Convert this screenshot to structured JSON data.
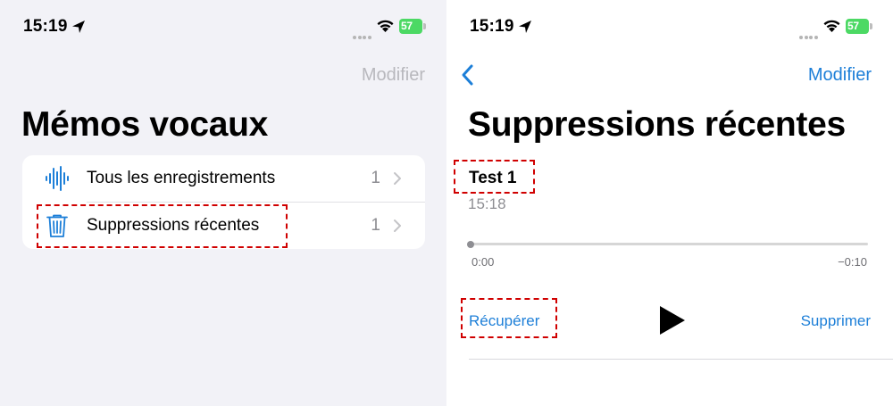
{
  "left_screen": {
    "status_time": "15:19",
    "battery_level": "57",
    "nav_edit_label": "Modifier",
    "title": "Mémos vocaux",
    "rows": [
      {
        "icon": "waveform-icon",
        "label": "Tous les enregistrements",
        "count": "1"
      },
      {
        "icon": "trash-icon",
        "label": "Suppressions récentes",
        "count": "1"
      }
    ]
  },
  "right_screen": {
    "status_time": "15:19",
    "battery_level": "57",
    "nav_edit_label": "Modifier",
    "title": "Suppressions récentes",
    "recording": {
      "name": "Test 1",
      "time": "15:18",
      "elapsed": "0:00",
      "remaining": "−0:10"
    },
    "recover_label": "Récupérer",
    "delete_label": "Supprimer"
  },
  "colors": {
    "accent_blue": "#1d7fd8",
    "disabled_gray": "#b8b8bd",
    "highlight_red": "#d00000",
    "battery_green": "#4cd964",
    "grouped_background": "#f2f2f7"
  }
}
